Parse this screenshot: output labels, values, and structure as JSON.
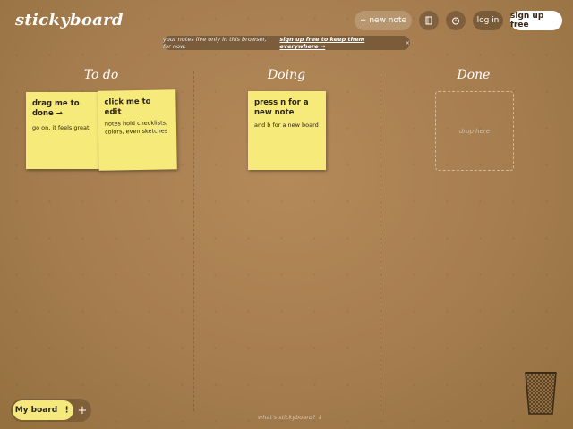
{
  "app": {
    "logo": "stickyboard"
  },
  "topbar": {
    "new_note": "+ new note",
    "login": "log in",
    "signup": "sign up free",
    "icons": [
      "book-icon",
      "timer-icon"
    ]
  },
  "notice": {
    "text": "your notes live only in this browser, for now.",
    "link": "sign up free to keep them everywhere →",
    "close": "×"
  },
  "columns": [
    {
      "title": "To do"
    },
    {
      "title": "Doing"
    },
    {
      "title": "Done"
    }
  ],
  "notes": [
    {
      "title": "drag me to done →",
      "body": "go on, it feels great"
    },
    {
      "title": "click me to edit",
      "body": "notes hold checklists, colors, even sketches"
    },
    {
      "title": "press n for a new note",
      "body": "and b for a new board"
    }
  ],
  "drop_zone": {
    "label": "drop here"
  },
  "board": {
    "name": "My board",
    "menu": "⋮",
    "add": "+"
  },
  "footer": {
    "whats": "what's stickyboard? ↓"
  },
  "colors": {
    "note": "#f6ea7a",
    "board_pill": "#f5e97e",
    "background": "#a67d4f"
  }
}
